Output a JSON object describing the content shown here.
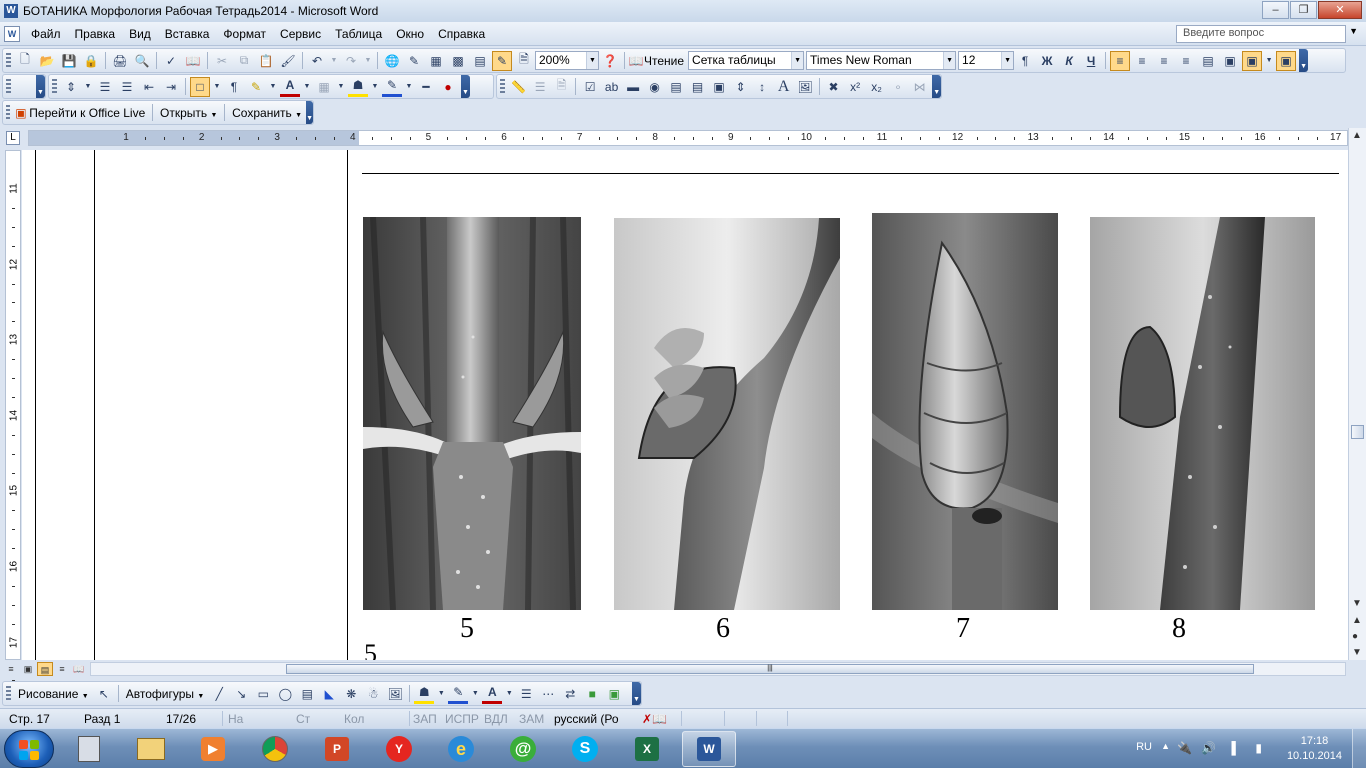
{
  "window": {
    "title": "БОТАНИКА Морфология Рабочая Тетрадь2014 - Microsoft Word",
    "app_icon": "W"
  },
  "menu": {
    "items": [
      "Файл",
      "Правка",
      "Вид",
      "Вставка",
      "Формат",
      "Сервис",
      "Таблица",
      "Окно",
      "Справка"
    ],
    "help_placeholder": "Введите вопрос"
  },
  "standard_toolbar": {
    "zoom": "200%",
    "reading_label": "Чтение",
    "table_grid_style": "Сетка таблицы",
    "font_name": "Times New Roman",
    "font_size": "12",
    "bold_glyph": "Ж",
    "italic_glyph": "К",
    "underline_glyph": "Ч"
  },
  "office_live_toolbar": {
    "go_label": "Перейти к Office Live",
    "open_label": "Открыть",
    "save_label": "Сохранить"
  },
  "ruler": {
    "tab_selector": "L",
    "numbers": [
      "1",
      "2",
      "3",
      "4",
      "5",
      "6",
      "7",
      "8",
      "9",
      "10",
      "11",
      "12",
      "13",
      "14",
      "15",
      "16",
      "17"
    ],
    "vertical_numbers": [
      "11",
      "12",
      "13",
      "14",
      "15",
      "16",
      "17"
    ]
  },
  "document": {
    "figures": [
      {
        "label": "5",
        "subject": "opposite buds with leaf scars"
      },
      {
        "label": "6",
        "subject": "lateral bud on twig"
      },
      {
        "label": "7",
        "subject": "terminal pointed bud"
      },
      {
        "label": "8",
        "subject": "ridged twig with axillary bud"
      }
    ],
    "next_caption_fragment": "5"
  },
  "draw_toolbar": {
    "draw_label": "Рисование",
    "autoshapes_label": "Автофигуры"
  },
  "status_bar": {
    "page": "Стр. 17",
    "section": "Разд 1",
    "page_of": "17/26",
    "at": "На",
    "line": "Ст",
    "col": "Кол",
    "rec": "ЗАП",
    "trk": "ИСПР",
    "ext": "ВДЛ",
    "ovr": "ЗАМ",
    "language": "русский (Ро"
  },
  "taskbar": {
    "apps": [
      "calculator",
      "explorer",
      "media-player",
      "chrome",
      "powerpoint",
      "yandex-browser",
      "internet-explorer",
      "mail-agent",
      "skype",
      "excel",
      "word"
    ],
    "active_app": "word",
    "language": "RU",
    "time": "17:18",
    "date": "10.10.2014"
  },
  "colors": {
    "chrome_blue": "#dbe4f1",
    "highlight": "#ffd98a",
    "taskbar": "#5b7ea9"
  }
}
